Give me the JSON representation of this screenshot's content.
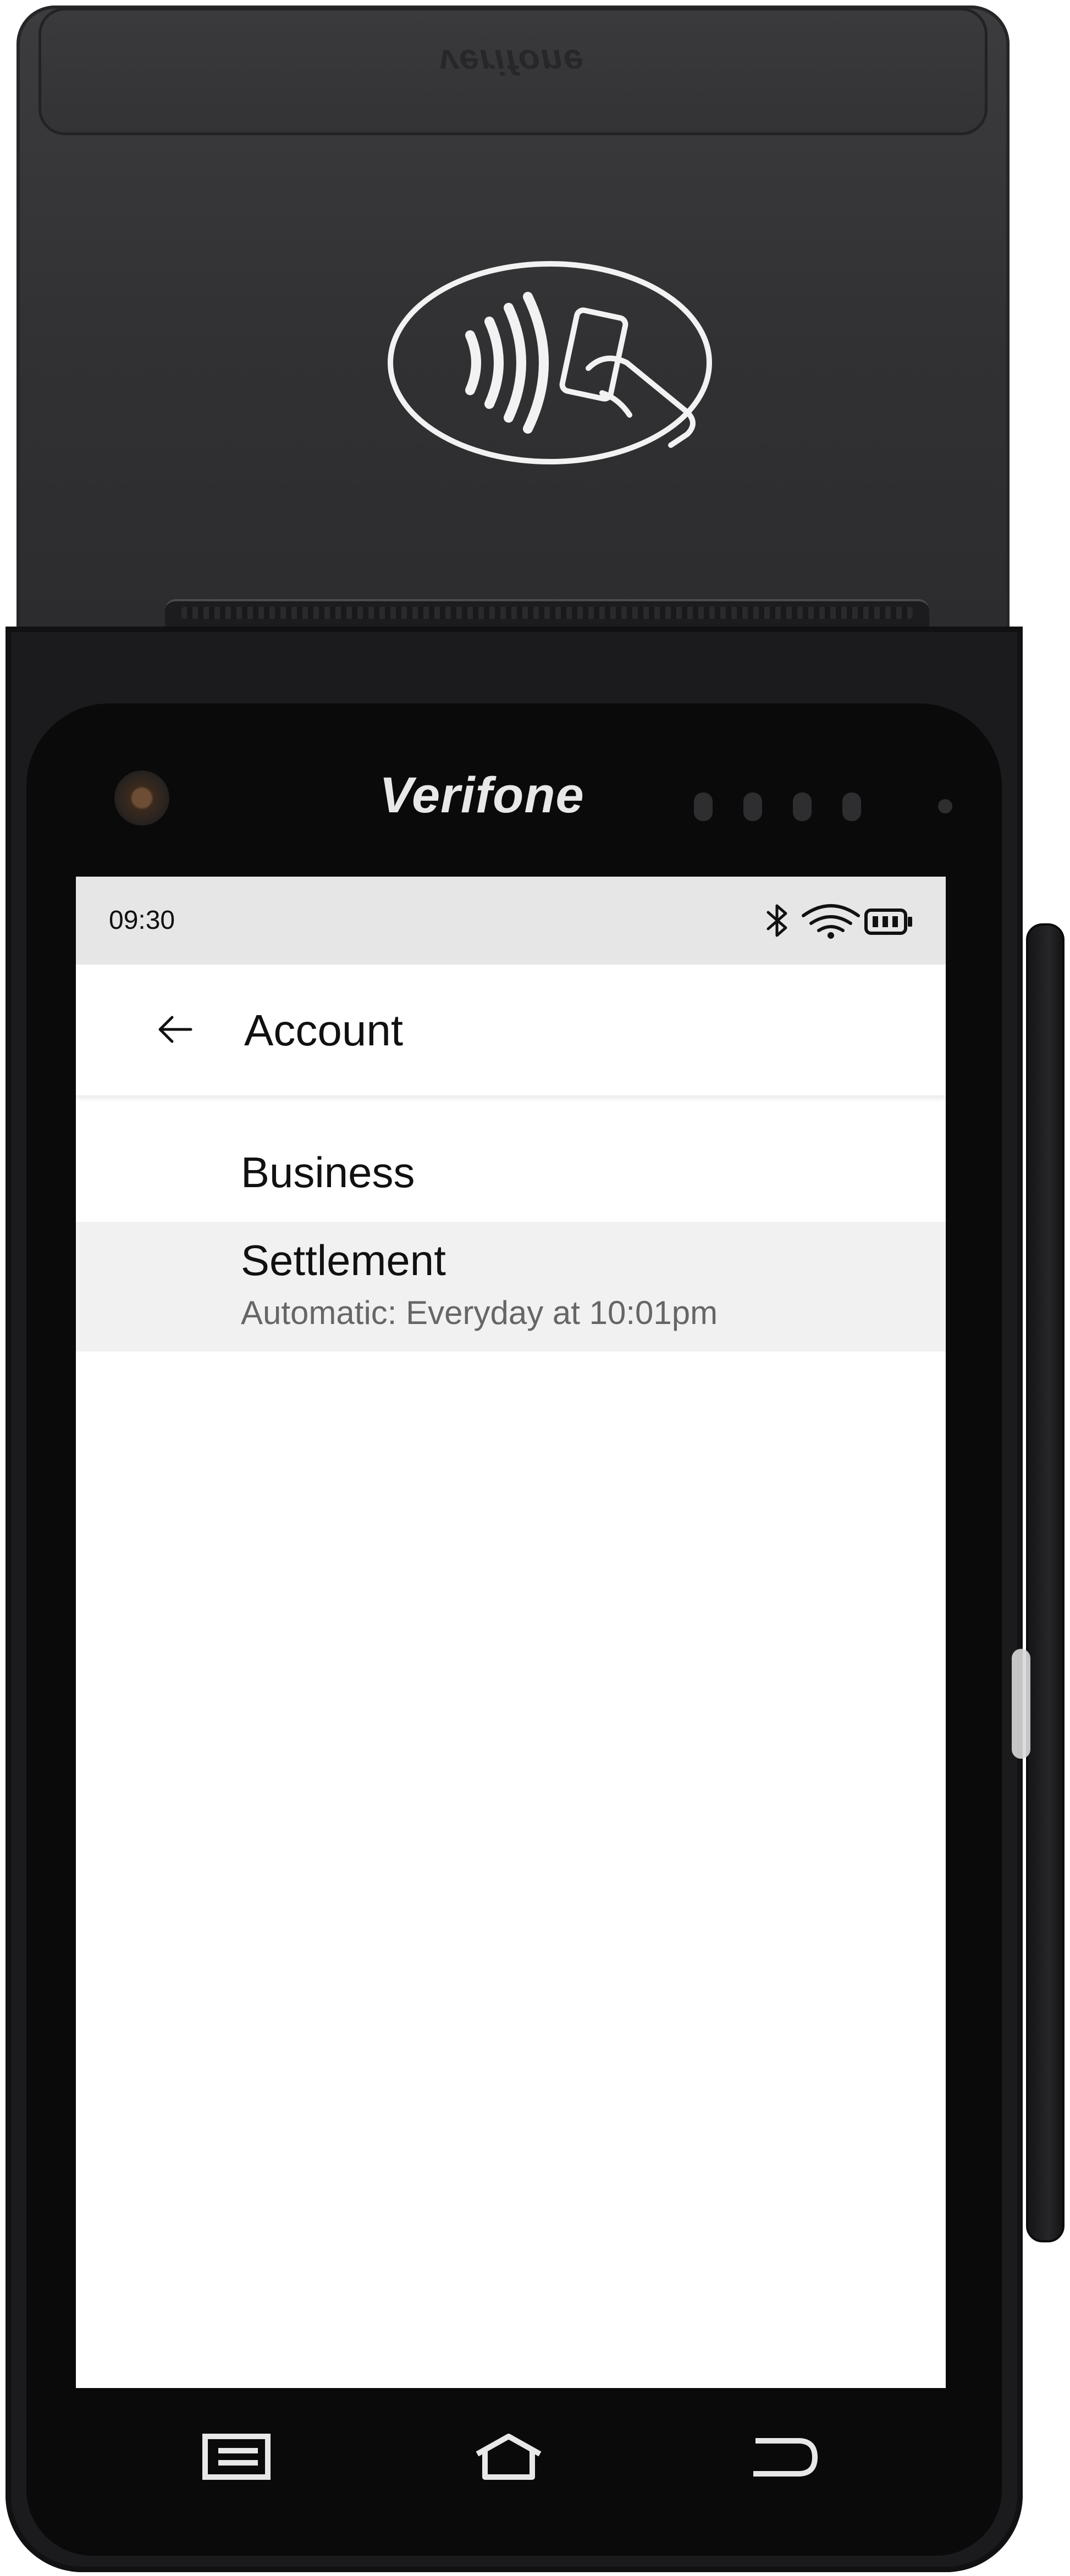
{
  "device": {
    "brand": "Verifone",
    "lid_emboss": "verifone"
  },
  "status_bar": {
    "time": "09:30",
    "icons": [
      "bluetooth-icon",
      "wifi-icon",
      "battery-icon"
    ]
  },
  "app_bar": {
    "back_icon": "arrow-left-icon",
    "title": "Account"
  },
  "list": {
    "items": [
      {
        "label": "Business"
      },
      {
        "label": "Settlement",
        "sublabel": "Automatic: Everyday at 10:01pm"
      }
    ]
  },
  "nav_bar": {
    "icons": [
      "menu-icon",
      "home-icon",
      "back-icon"
    ]
  },
  "colors": {
    "status_bar_bg": "#e6e6e6",
    "selected_row_bg": "#f1f1f1",
    "device_body": "#1b1b1d",
    "text_primary": "#111111",
    "text_secondary": "#666666"
  }
}
